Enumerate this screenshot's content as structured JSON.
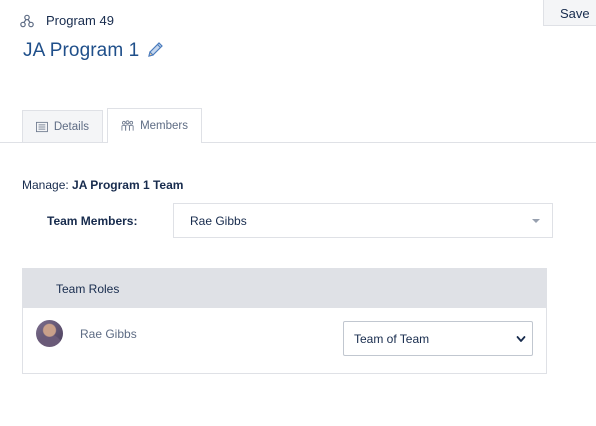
{
  "header": {
    "save_label": "Save",
    "program_label": "Program 49",
    "page_title": "JA Program 1"
  },
  "tabs": [
    {
      "label": "Details",
      "icon": "document-icon",
      "active": false
    },
    {
      "label": "Members",
      "icon": "people-icon",
      "active": true
    }
  ],
  "manage": {
    "prefix": "Manage:",
    "team_name": "JA Program 1 Team"
  },
  "team_members": {
    "label": "Team Members:",
    "selected": "Rae Gibbs"
  },
  "team_roles": {
    "header": "Team Roles",
    "rows": [
      {
        "name": "Rae Gibbs",
        "role": "Team of Team"
      }
    ]
  },
  "colors": {
    "title": "#1f4f8a",
    "tab_inactive_bg": "#f4f5f7",
    "roles_header_bg": "#dfe1e6"
  }
}
